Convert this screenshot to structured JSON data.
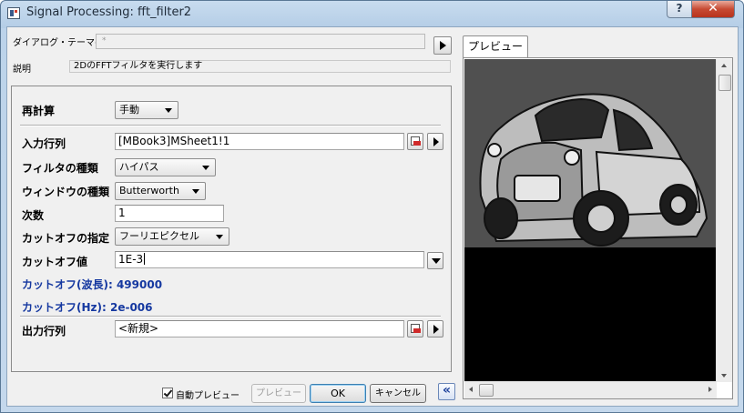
{
  "window": {
    "title": "Signal Processing: fft_filter2",
    "help_label": "?",
    "close_label": "✕"
  },
  "theme": {
    "label": "ダイアログ・テーマ(H)",
    "value": "*"
  },
  "description": {
    "label": "説明",
    "value": "2DのFFTフィルタを実行します"
  },
  "form": {
    "recalc_label": "再計算",
    "recalc_value": "手動",
    "input_label": "入力行列",
    "input_value": "[MBook3]MSheet1!1",
    "filter_type_label": "フィルタの種類",
    "filter_type_value": "ハイパス",
    "window_type_label": "ウィンドウの種類",
    "window_type_value": "Butterworth",
    "order_label": "次数",
    "order_value": "1",
    "cutoff_spec_label": "カットオフの指定",
    "cutoff_spec_value": "フーリエピクセル",
    "cutoff_value_label": "カットオフ値",
    "cutoff_value": "1E-3",
    "cutoff_wavelength_text": "カットオフ(波長): 499000",
    "cutoff_hz_text": "カットオフ(Hz): 2e-006",
    "output_label": "出力行列",
    "output_value": "<新規>"
  },
  "buttons": {
    "auto_preview_label": "自動プレビュー",
    "auto_preview_checked": true,
    "preview_label": "プレビュー",
    "ok_label": "OK",
    "cancel_label": "キャンセル",
    "collapse_label": "«"
  },
  "preview": {
    "tab_label": "プレビュー"
  },
  "colors": {
    "accent_blue": "#1538a0",
    "close_red": "#c74a33"
  }
}
